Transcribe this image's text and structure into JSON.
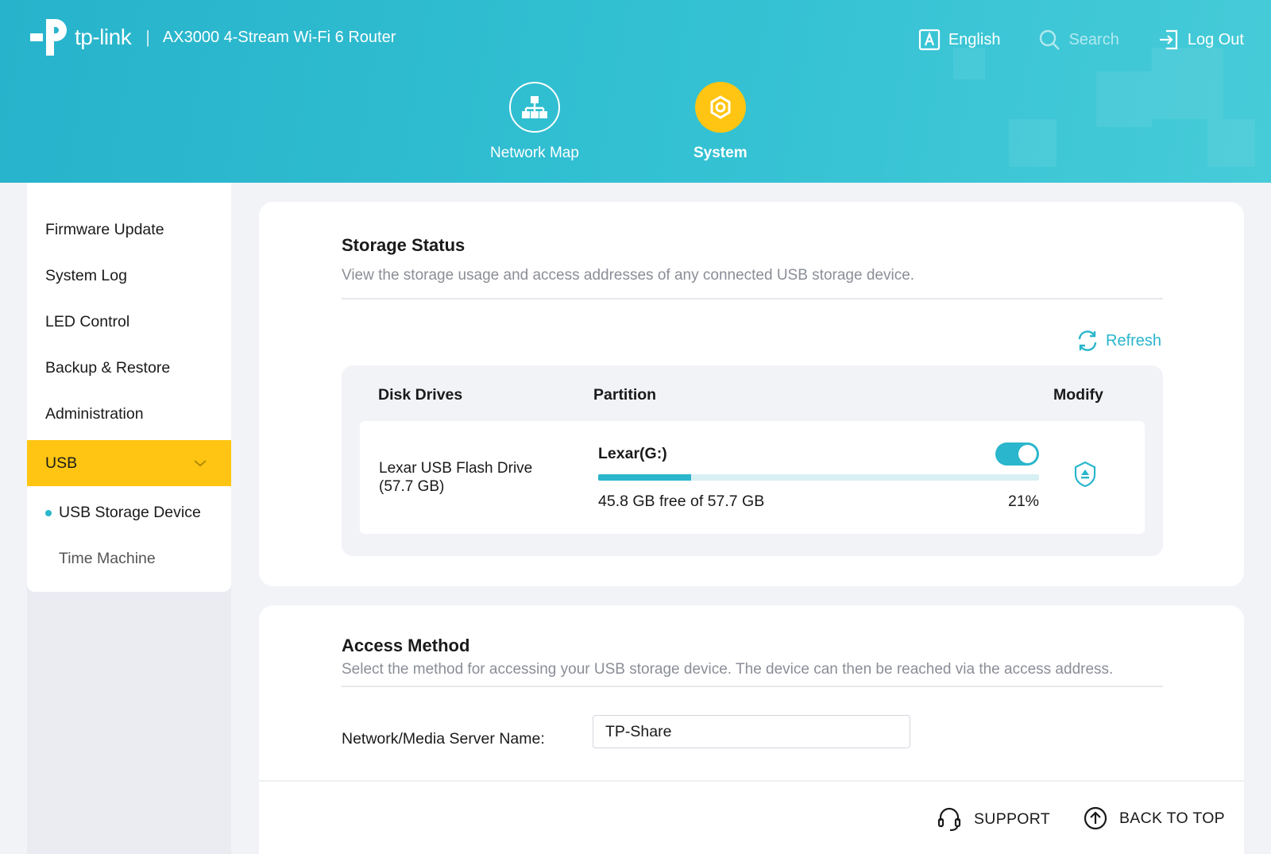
{
  "header": {
    "brand": "tp-link",
    "model": "AX3000 4-Stream Wi-Fi 6 Router",
    "language_label": "English",
    "search_label": "Search",
    "logout_label": "Log Out"
  },
  "main_nav": [
    {
      "label": "Network Map",
      "icon": "network-map-icon",
      "active": false
    },
    {
      "label": "System",
      "icon": "gear-icon",
      "active": true
    }
  ],
  "sidebar": {
    "items": [
      {
        "label": "Firmware Update"
      },
      {
        "label": "System Log"
      },
      {
        "label": "LED Control"
      },
      {
        "label": "Backup & Restore"
      },
      {
        "label": "Administration"
      },
      {
        "label": "USB",
        "expanded": true
      }
    ],
    "sub_items": [
      {
        "label": "USB Storage Device",
        "active": true
      },
      {
        "label": "Time Machine",
        "active": false
      }
    ]
  },
  "storage_status": {
    "title": "Storage Status",
    "description": "View the storage usage and access addresses of any connected USB storage device.",
    "refresh_label": "Refresh",
    "columns": [
      "Disk Drives",
      "Partition",
      "Modify"
    ],
    "rows": [
      {
        "disk": "Lexar USB Flash Drive (57.7 GB)",
        "partition": "Lexar(G:)",
        "enabled": true,
        "free_text": "45.8 GB free of 57.7 GB",
        "used_percent": 21,
        "used_percent_label": "21%"
      }
    ]
  },
  "access_method": {
    "title": "Access Method",
    "description": "Select the method for accessing your USB storage device. The device can then be reached via the access address.",
    "server_name_label": "Network/Media Server Name:",
    "server_name_value": "TP-Share"
  },
  "footer": {
    "support_label": "SUPPORT",
    "back_to_top_label": "BACK TO TOP"
  },
  "colors": {
    "accent": "#2ab6cc",
    "highlight": "#ffc512",
    "header_bg": "#33c1d3"
  }
}
